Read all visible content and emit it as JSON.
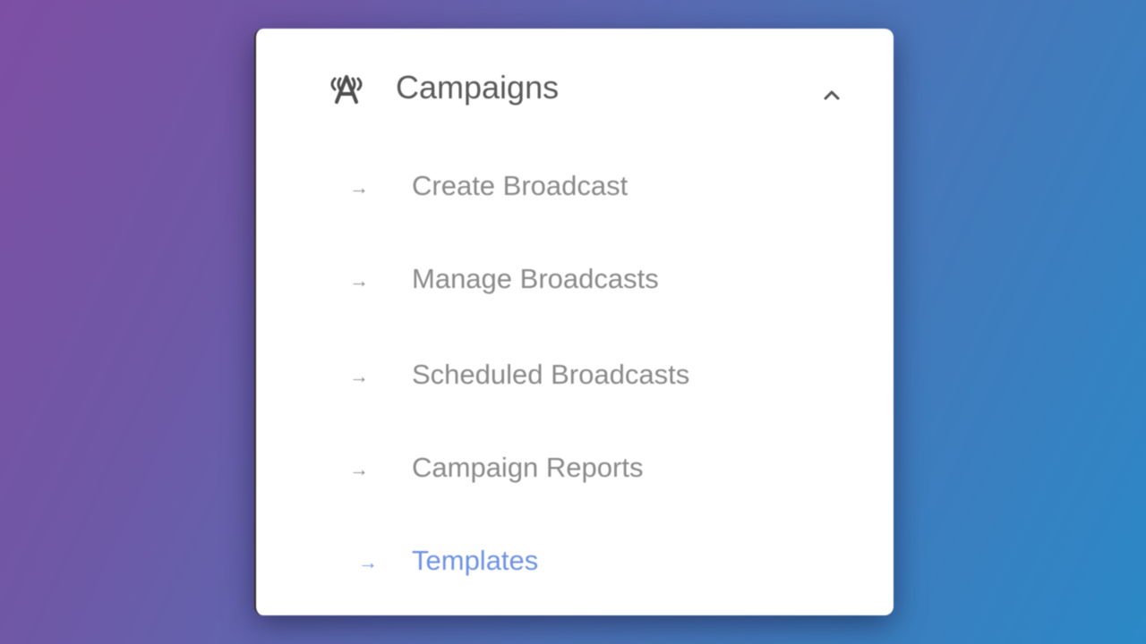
{
  "menu": {
    "header": {
      "title": "Campaigns",
      "icon": "broadcast-tower-icon",
      "toggle_icon": "chevron-up-icon"
    },
    "items": [
      {
        "label": "Create Broadcast",
        "arrow": "→",
        "active": false
      },
      {
        "label": "Manage Broadcasts",
        "arrow": "→",
        "active": false
      },
      {
        "label": "Scheduled Broadcasts",
        "arrow": "→",
        "active": false
      },
      {
        "label": "Campaign Reports",
        "arrow": "→",
        "active": false
      },
      {
        "label": "Templates",
        "arrow": "→",
        "active": true
      }
    ]
  },
  "colors": {
    "active": "#6f93e6",
    "inactive": "#8a8a8a",
    "header_text": "#5a5a5a",
    "card_background": "#ffffff"
  }
}
